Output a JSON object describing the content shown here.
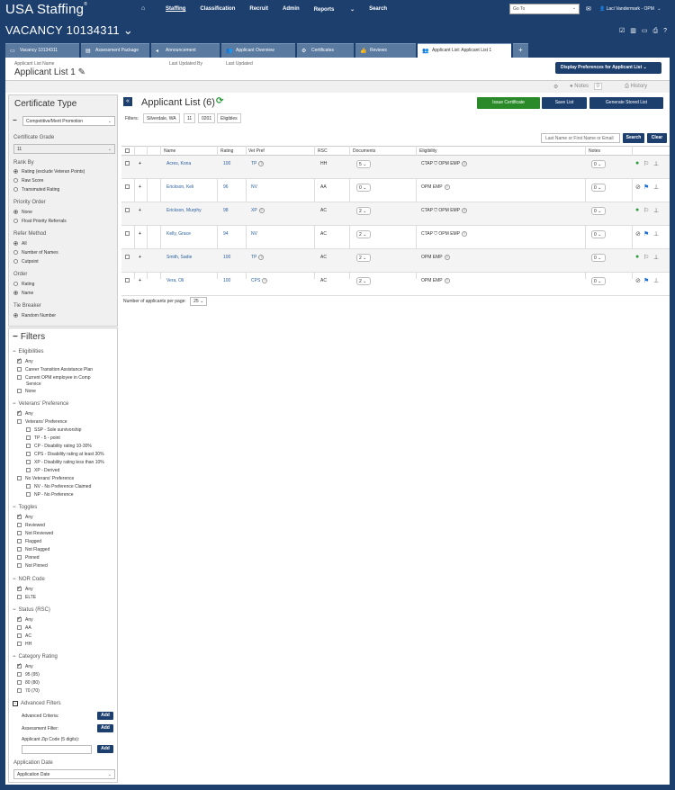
{
  "topnav": {
    "logo": "USA Staffing",
    "logo_mark": "®",
    "home_icon": "home-icon",
    "items": [
      "Staffing",
      "Classification",
      "Recruit",
      "Admin",
      "Reports",
      "Search"
    ],
    "goto_placeholder": "Go To",
    "user": "Laci Vandermark - OPM"
  },
  "vacancy": {
    "title": "VACANCY 10134311"
  },
  "tabs": [
    {
      "label": "Vacancy 10134311"
    },
    {
      "label": "Assessment Package"
    },
    {
      "label": "Announcement"
    },
    {
      "label": "Applicant Overview"
    },
    {
      "label": "Certificates"
    },
    {
      "label": "Reviews"
    },
    {
      "label": "Applicant List: Applicant List 1"
    }
  ],
  "header": {
    "list_name_label": "Applicant List Name",
    "list_name": "Applicant List 1",
    "updated_by_label": "Last Updated By",
    "updated_label": "Last Updated",
    "display_prefs": "Display Preferences for Applicant List"
  },
  "notesbar": {
    "notes_label": "Notes",
    "notes_count": "0",
    "history_label": "History"
  },
  "certificate": {
    "title": "Certificate Type",
    "type_value": "Competitive/Merit Promotion",
    "grade_label": "Certificate Grade",
    "grade_value": "11",
    "rank_by_label": "Rank By",
    "rank_by": [
      "Rating (exclude Veteran Points)",
      "Raw Score",
      "Transmuted Rating"
    ],
    "priority_label": "Priority Order",
    "priority": [
      "None",
      "Float Priority Referrals"
    ],
    "refer_label": "Refer Method",
    "refer": [
      "All",
      "Number of Names",
      "Cutpoint"
    ],
    "order_label": "Order",
    "order": [
      "Rating",
      "Name"
    ],
    "tie_label": "Tie Breaker",
    "tie": [
      "Random Number"
    ]
  },
  "filters_panel": {
    "title": "Filters",
    "eligibilities_label": "Eligibilities",
    "eligibilities": [
      "Any",
      "Career Transition Assistance Plan",
      "Current OPM employee in Comp",
      "Service",
      "None"
    ],
    "vet_label": "Veterans' Preference",
    "vet": [
      "Any",
      "Veterans' Preference",
      "SSP - Sole survivorship",
      "TP - 5 - point",
      "CP - Disability rating 10-30%",
      "CPS - Disability rating at least 30%",
      "XP - Disability rating less than 10%",
      "XP - Derived",
      "No Veterans' Preference",
      "NV - No Preference Claimed",
      "NP - No Preference"
    ],
    "toggles_label": "Toggles",
    "toggles": [
      "Any",
      "Reviewed",
      "Not Reviewed",
      "Flagged",
      "Not Flagged",
      "Pinned",
      "Not Pinned"
    ],
    "nor_label": "NOR Code",
    "nor": [
      "Any",
      "ELTE"
    ],
    "status_label": "Status (RSC)",
    "status": [
      "Any",
      "AA",
      "AC",
      "HH"
    ],
    "category_label": "Category Rating",
    "category": [
      "Any",
      "95 (95)",
      "80 (80)",
      "70 (70)"
    ],
    "advanced_label": "Advanced Filters",
    "adv_criteria": "Advanced Criteria:",
    "assessment_filter": "Assessment Filter:",
    "zip_label": "Applicant Zip Code (5 digits):",
    "add": "Add",
    "app_date_label": "Application Date",
    "app_date_value": "Application Date"
  },
  "list": {
    "title": "Applicant List (6)",
    "issue_btn": "Issue Certificate",
    "save_btn": "Save List",
    "gen_btn": "Generate Stored List",
    "filters_label": "Filters:",
    "filter_pills": [
      "Silverdale, WA",
      "11",
      "0201",
      "Eligibles"
    ],
    "search_placeholder": "Last Name or First Name or Email",
    "search_btn": "Search",
    "clear_btn": "Clear",
    "columns": [
      "Name",
      "Rating",
      "Vet Pref",
      "RSC",
      "Documents",
      "Eligibility",
      "Notes"
    ],
    "rows": [
      {
        "name": "Acres, Kona",
        "rating": "100",
        "vet": "TP",
        "rsc": "HH",
        "docs": "5",
        "elig_a": "CTAP",
        "elig_b": "OPM EMP",
        "notes": "0",
        "status": "approved",
        "flagged": false
      },
      {
        "name": "Erickson, Keli",
        "rating": "96",
        "vet": "NV",
        "rsc": "AA",
        "docs": "0",
        "elig_a": "",
        "elig_b": "OPM EMP",
        "notes": "0",
        "status": "pending",
        "flagged": true
      },
      {
        "name": "Erickson, Murphy",
        "rating": "98",
        "vet": "XP",
        "rsc": "AC",
        "docs": "2",
        "elig_a": "CTAP",
        "elig_b": "OPM EMP",
        "notes": "0",
        "status": "approved",
        "flagged": false
      },
      {
        "name": "Kelly, Grace",
        "rating": "94",
        "vet": "NV",
        "rsc": "AC",
        "docs": "2",
        "elig_a": "CTAP",
        "elig_b": "OPM EMP",
        "notes": "0",
        "status": "pending",
        "flagged": true
      },
      {
        "name": "Smith, Sadie",
        "rating": "100",
        "vet": "TP",
        "rsc": "AC",
        "docs": "2",
        "elig_a": "",
        "elig_b": "OPM EMP",
        "notes": "0",
        "status": "approved",
        "flagged": false
      },
      {
        "name": "Vera, Oli",
        "rating": "100",
        "vet": "CPS",
        "rsc": "AC",
        "docs": "2",
        "elig_a": "",
        "elig_b": "OPM EMP",
        "notes": "0",
        "status": "pending",
        "flagged": true
      }
    ],
    "per_page_label": "Number of applicants per page:",
    "per_page_value": "25"
  },
  "colors": {
    "navy": "#1c3f6e",
    "green": "#2a9a3a",
    "link": "#2a5fa0",
    "flag": "#1c6fd0"
  }
}
